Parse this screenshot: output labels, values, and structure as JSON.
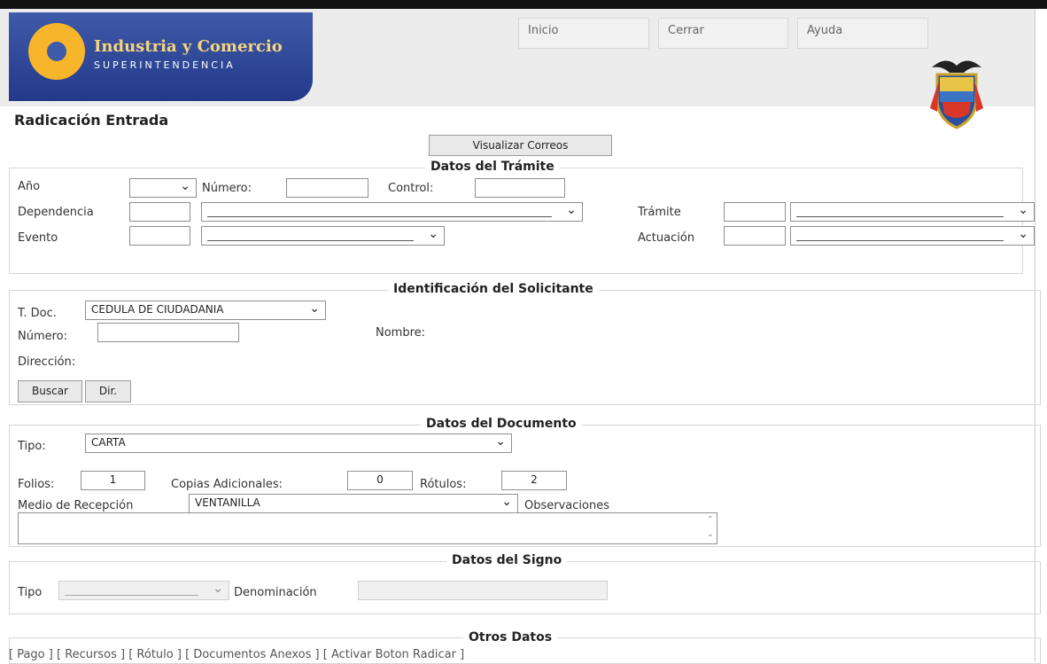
{
  "header": {
    "logo_title": "Industria y Comercio",
    "logo_subtitle": "SUPERINTENDENCIA",
    "nav": [
      "Inicio",
      "Cerrar",
      "Ayuda"
    ]
  },
  "page": {
    "title": "Radicación Entrada",
    "view_mail_button": "Visualizar Correos"
  },
  "tramite": {
    "legend": "Datos del Trámite",
    "anio_label": "Año",
    "numero_label": "Número:",
    "control_label": "Control:",
    "dependencia_label": "Dependencia",
    "tramite_label": "Trámite",
    "evento_label": "Evento",
    "actuacion_label": "Actuación"
  },
  "solicitante": {
    "legend": "Identificación del Solicitante",
    "tdoc_label": "T. Doc.",
    "tdoc_value": "CEDULA DE CIUDADANIA",
    "numero_label": "Número:",
    "nombre_label": "Nombre:",
    "direccion_label": "Dirección:",
    "buscar_button": "Buscar",
    "dir_button": "Dir."
  },
  "documento": {
    "legend": "Datos del Documento",
    "tipo_label": "Tipo:",
    "tipo_value": "CARTA",
    "folios_label": "Folios:",
    "folios_value": "1",
    "copias_label": "Copias Adicionales:",
    "copias_value": "0",
    "rotulos_label": "Rótulos:",
    "rotulos_value": "2",
    "medio_label": "Medio de Recepción",
    "medio_value": "VENTANILLA",
    "observaciones_label": "Observaciones"
  },
  "signo": {
    "legend": "Datos del Signo",
    "tipo_label": "Tipo",
    "denominacion_label": "Denominación"
  },
  "otros": {
    "legend": "Otros Datos",
    "links": [
      "[ Pago ]",
      "[ Recursos ]",
      "[ Rótulo ]",
      "[ Documentos Anexos ]",
      "[ Activar Boton Radicar ]"
    ]
  }
}
